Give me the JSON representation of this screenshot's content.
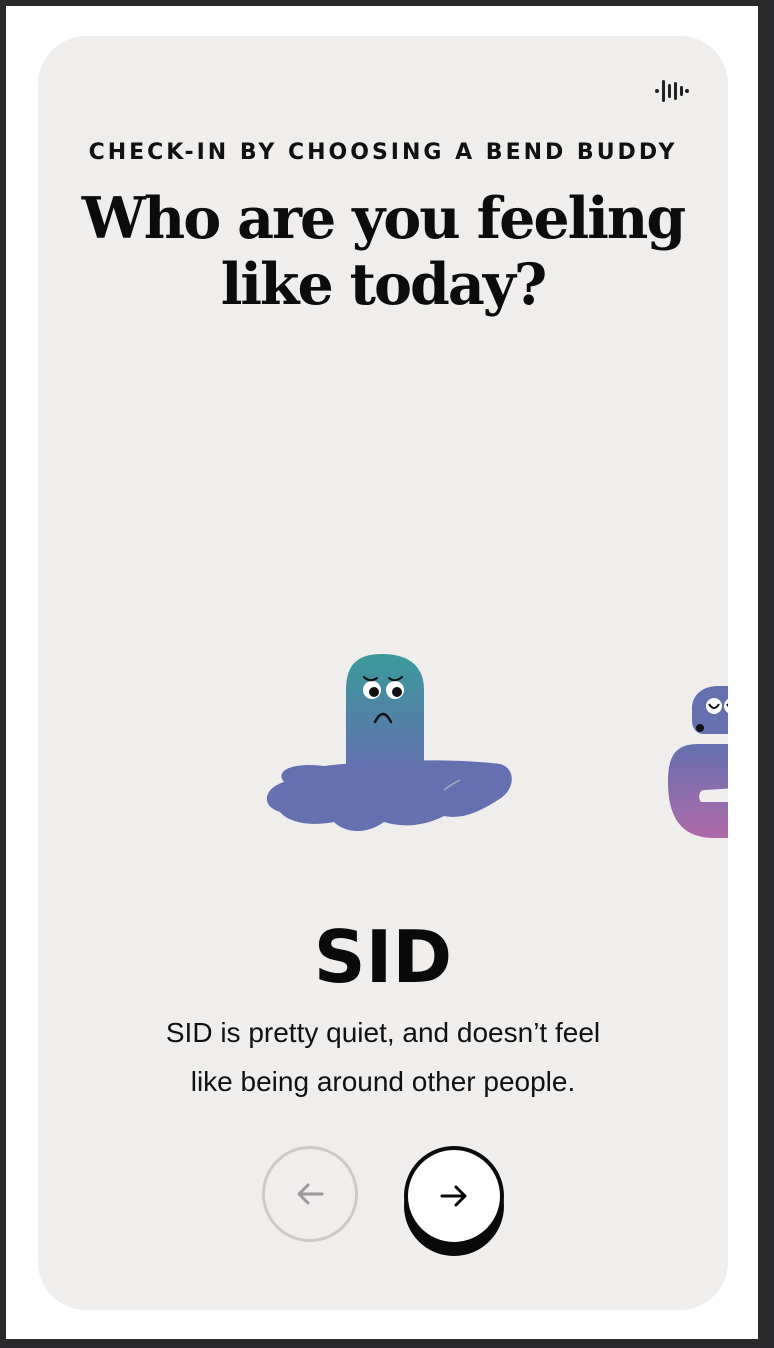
{
  "header": {
    "audio_icon": "audio-waveform-icon",
    "eyebrow": "CHECK-IN BY CHOOSING A BEND BUDDY",
    "headline_line1": "Who are you feeling",
    "headline_line2": "like today?"
  },
  "buddy": {
    "name": "SID",
    "description_line1": "SID is pretty quiet, and doesn’t feel",
    "description_line2": "like being around other people."
  },
  "navigation": {
    "prev_icon": "arrow-left-icon",
    "next_icon": "arrow-right-icon"
  },
  "colors": {
    "card_background": "#efeeed",
    "buddy_teal": "#3a9a9a",
    "buddy_purple": "#6b6fb4",
    "accent_pink": "#b06aa8",
    "text": "#0a0a0a"
  }
}
